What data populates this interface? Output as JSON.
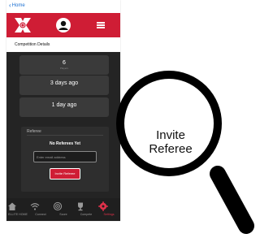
{
  "browser": {
    "back_label": "Home"
  },
  "header": {
    "menu_icon": "hamburger-icon",
    "logo_icon": "app-logo-icon",
    "avatar_icon": "user-avatar-icon"
  },
  "page": {
    "title": "Competition Details"
  },
  "stats": [
    {
      "value": "6",
      "label": "Players"
    },
    {
      "value": "3 days ago",
      "label": ""
    },
    {
      "value": "1 day ago",
      "label": ""
    }
  ],
  "referee_panel": {
    "title": "Referee",
    "empty_message": "No Referees Yet",
    "email_placeholder": "Enter email address",
    "invite_button": "Invite Referee"
  },
  "nav": [
    {
      "label": "ELLITE HOME",
      "icon": "home-icon"
    },
    {
      "label": "Connect",
      "icon": "wifi-icon"
    },
    {
      "label": "Score",
      "icon": "target-icon"
    },
    {
      "label": "Compete",
      "icon": "trophy-icon"
    },
    {
      "label": "Settings",
      "icon": "gear-icon"
    }
  ],
  "callout": {
    "text_line1": "Invite",
    "text_line2": "Referee"
  },
  "colors": {
    "brand": "#cf1d35",
    "dark_bg": "#242424",
    "card": "#3a3a3a",
    "link": "#1a6fd1"
  }
}
